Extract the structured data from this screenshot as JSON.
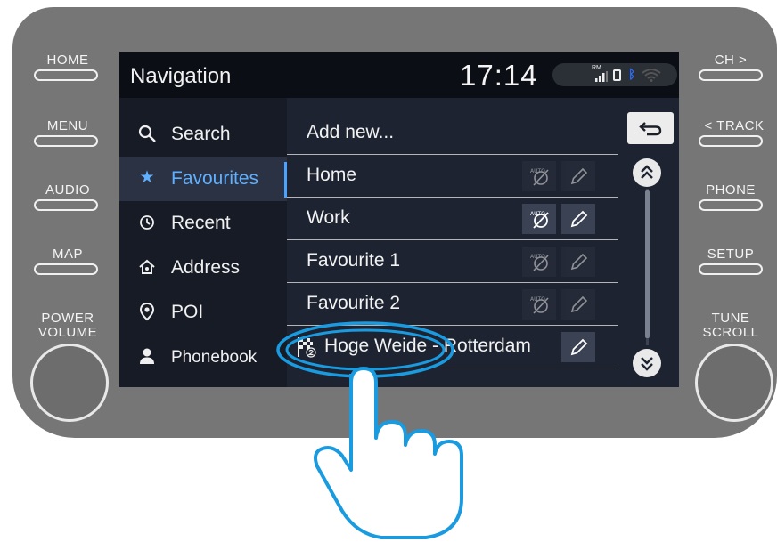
{
  "hardware": {
    "left_buttons": [
      "HOME",
      "MENU",
      "AUDIO",
      "MAP"
    ],
    "right_buttons": [
      "CH >",
      "< TRACK",
      "PHONE",
      "SETUP"
    ],
    "left_knob_label": [
      "POWER",
      "VOLUME"
    ],
    "right_knob_label": [
      "TUNE",
      "SCROLL"
    ]
  },
  "status": {
    "title": "Navigation",
    "time": "17:14",
    "rm_label": "RM",
    "bluetooth_color": "#2b6cff"
  },
  "menu": {
    "items": [
      {
        "label": "Search",
        "icon": "search-icon",
        "active": false
      },
      {
        "label": "Favourites",
        "icon": "star-icon",
        "active": true
      },
      {
        "label": "Recent",
        "icon": "clock-icon",
        "active": false
      },
      {
        "label": "Address",
        "icon": "address-icon",
        "active": false
      },
      {
        "label": "POI",
        "icon": "pin-icon",
        "active": false
      },
      {
        "label": "Phonebook",
        "icon": "person-icon",
        "active": false
      }
    ]
  },
  "list": {
    "rows": [
      {
        "label": "Add new...",
        "auto": "none",
        "edit": "none"
      },
      {
        "label": "Home",
        "auto": "disabled",
        "edit": "disabled"
      },
      {
        "label": "Work",
        "auto": "enabled",
        "edit": "enabled"
      },
      {
        "label": "Favourite 1",
        "auto": "disabled",
        "edit": "disabled"
      },
      {
        "label": "Favourite 2",
        "auto": "disabled",
        "edit": "disabled"
      },
      {
        "label": "Hoge Weide - Rotterdam",
        "auto": "none",
        "edit": "enabled",
        "icon": "finish-flag-icon"
      }
    ],
    "auto_badge": "AUTO"
  },
  "colors": {
    "accent": "#4aa3ff",
    "highlight_ring": "#1a9be0",
    "hand_outline": "#1a9be0"
  }
}
